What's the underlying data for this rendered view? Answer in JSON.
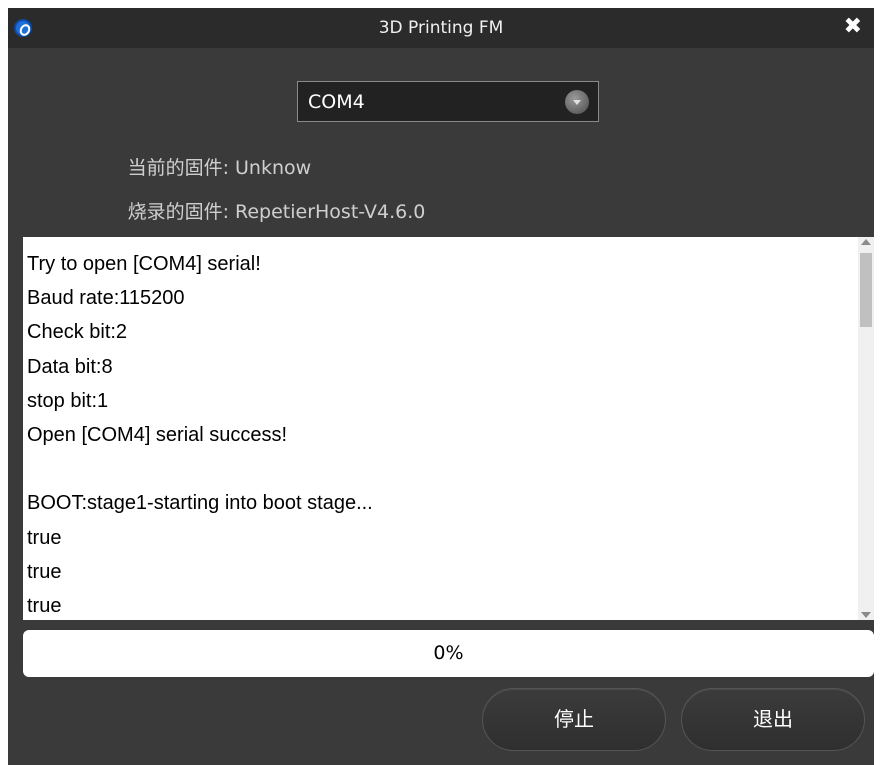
{
  "window": {
    "title": "3D Printing FM",
    "close_glyph": "✖"
  },
  "port": {
    "selected": "COM4"
  },
  "firmware": {
    "current_label": "当前的固件:",
    "current_value": "Unknow",
    "burn_label": "烧录的固件:",
    "burn_value": "RepetierHost-V4.6.0"
  },
  "log": {
    "lines": [
      "Try to open [COM4] serial!",
      "Baud rate:115200",
      "Check bit:2",
      "Data bit:8",
      "stop bit:1",
      "Open [COM4] serial success!",
      "",
      "BOOT:stage1-starting into boot stage...",
      "true",
      "true",
      "true"
    ]
  },
  "progress": {
    "percent": 0,
    "label": "0%"
  },
  "buttons": {
    "stop_label": "停止",
    "exit_label": "退出"
  },
  "icons": {
    "app": "app-logo-icon",
    "close": "close-icon",
    "dropdown": "chevron-down-icon",
    "scroll_up": "scroll-up-icon",
    "scroll_down": "scroll-down-icon"
  }
}
